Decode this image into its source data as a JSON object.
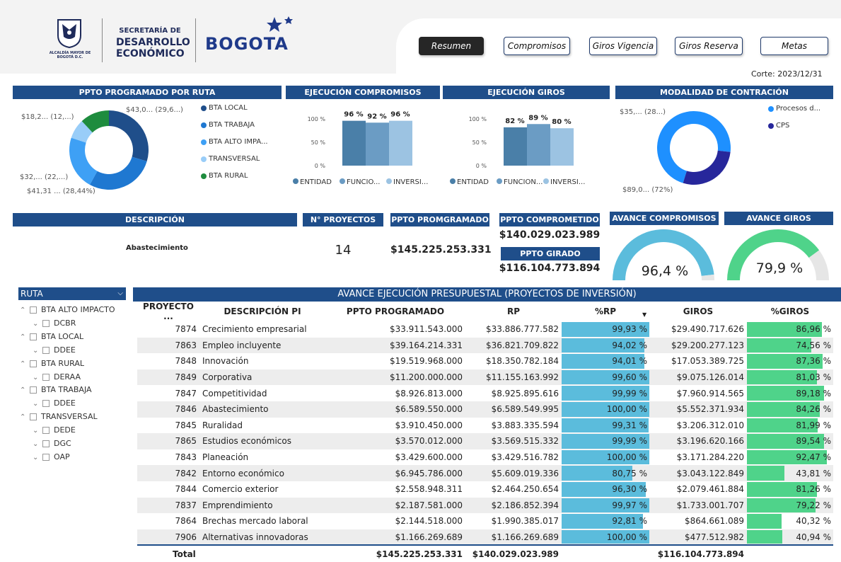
{
  "header": {
    "alcaldia_text": "ALCALDÍA MAYOR DE BOGOTÁ D.C.",
    "secretaria_line1": "SECRETARÍA DE",
    "secretaria_line2": "DESARROLLO",
    "secretaria_line3": "ECONÓMICO",
    "bogota_logo": "BOGOTA"
  },
  "nav": {
    "resumen": "Resumen",
    "compromisos": "Compromisos",
    "giros_vigencia": "Giros Vigencia",
    "giros_reserva": "Giros Reserva",
    "metas": "Metas"
  },
  "corte": "Corte: 2023/12/31",
  "ppto_ruta": {
    "title": "PPTO PROGRAMADO POR RUTA",
    "labels": {
      "local": "$43,0... (29,6...)",
      "rural": "$18,2... (12,...)",
      "transversal": "$32,... (22,...)",
      "trabajo": "$41,31 ... (28,44%)"
    },
    "legend": [
      "BTA LOCAL",
      "BTA TRABAJA",
      "BTA ALTO IMPA...",
      "TRANSVERSAL",
      "BTA RURAL"
    ],
    "colors": [
      "#1f4e8a",
      "#1f78d1",
      "#3ea0f5",
      "#99cdf8",
      "#1e8c3e"
    ]
  },
  "ejec_compromisos": {
    "title": "EJECUCIÓN COMPROMISOS",
    "y_ticks": [
      "100 %",
      "50 %",
      "0 %"
    ],
    "bar_labels": [
      "96 %",
      "92 %",
      "96 %"
    ],
    "legend": [
      "ENTIDAD",
      "FUNCIO...",
      "INVERSI..."
    ]
  },
  "ejec_giros": {
    "title": "EJECUCIÓN GIROS",
    "y_ticks": [
      "100 %",
      "50 %",
      "0 %"
    ],
    "bar_labels": [
      "82 %",
      "89 %",
      "80 %"
    ],
    "legend": [
      "ENTIDAD",
      "FUNCION...",
      "INVERSI..."
    ]
  },
  "modalidad": {
    "title": "MODALIDAD DE CONTRACIÓN",
    "label_top": "$35,... (28...)",
    "label_bottom": "$89,0... (72%)",
    "legend": [
      "Procesos d...",
      "CPS"
    ]
  },
  "kpi": {
    "descripcion_header": "DESCRIPCIÓN",
    "descripcion_value": "Abastecimiento",
    "n_proyectos_header": "N° PROYECTOS",
    "n_proyectos_value": "14",
    "ppto_prog_header": "PPTO PROMGRAMADO",
    "ppto_prog_value": "$145.225.253.331",
    "ppto_comp_header": "PPTO COMPROMETIDO",
    "ppto_comp_value": "$140.029.023.989",
    "ppto_girado_header": "PPTO GIRADO",
    "ppto_girado_value": "$116.104.773.894",
    "avance_comp_header": "AVANCE COMPROMISOS",
    "avance_comp_value": "96,4 %",
    "avance_giros_header": "AVANCE GIROS",
    "avance_giros_value": "79,9 %"
  },
  "slicer": {
    "title": "RUTA",
    "items": [
      {
        "label": "BTA ALTO IMPACTO",
        "level": 0
      },
      {
        "label": "DCBR",
        "level": 1
      },
      {
        "label": "BTA LOCAL",
        "level": 0
      },
      {
        "label": "DDEE",
        "level": 1
      },
      {
        "label": "BTA RURAL",
        "level": 0
      },
      {
        "label": "DERAA",
        "level": 1
      },
      {
        "label": "BTA TRABAJA",
        "level": 0
      },
      {
        "label": "DDEE",
        "level": 1
      },
      {
        "label": "TRANSVERSAL",
        "level": 0
      },
      {
        "label": "DEDE",
        "level": 1
      },
      {
        "label": "DGC",
        "level": 1
      },
      {
        "label": "OAP",
        "level": 1
      }
    ]
  },
  "table": {
    "title": "AVANCE EJECUCIÓN PRESUPUESTAL (PROYECTOS DE INVERSIÓN)",
    "columns": [
      "PROYECTO ...",
      "DESCRIPCIÓN PI",
      "PPTO PROGRAMADO",
      "RP",
      "%RP",
      "GIROS",
      "%GIROS"
    ],
    "rows": [
      {
        "proyecto": "7874",
        "descripcion": "Crecimiento empresarial",
        "ppto": "$33.911.543.000",
        "rp": "$33.886.777.582",
        "pct_rp": "99,93 %",
        "rp_val": 99.93,
        "giros": "$29.490.717.626",
        "pct_giros": "86,96 %",
        "giros_val": 86.96
      },
      {
        "proyecto": "7863",
        "descripcion": "Empleo incluyente",
        "ppto": "$39.164.214.331",
        "rp": "$36.821.709.822",
        "pct_rp": "94,02 %",
        "rp_val": 94.02,
        "giros": "$29.200.277.123",
        "pct_giros": "74,56 %",
        "giros_val": 74.56
      },
      {
        "proyecto": "7848",
        "descripcion": "Innovación",
        "ppto": "$19.519.968.000",
        "rp": "$18.350.782.184",
        "pct_rp": "94,01 %",
        "rp_val": 94.01,
        "giros": "$17.053.389.725",
        "pct_giros": "87,36 %",
        "giros_val": 87.36
      },
      {
        "proyecto": "7849",
        "descripcion": "Corporativa",
        "ppto": "$11.200.000.000",
        "rp": "$11.155.163.992",
        "pct_rp": "99,60 %",
        "rp_val": 99.6,
        "giros": "$9.075.126.014",
        "pct_giros": "81,03 %",
        "giros_val": 81.03
      },
      {
        "proyecto": "7847",
        "descripcion": "Competitividad",
        "ppto": "$8.926.813.000",
        "rp": "$8.925.895.616",
        "pct_rp": "99,99 %",
        "rp_val": 99.99,
        "giros": "$7.960.914.565",
        "pct_giros": "89,18 %",
        "giros_val": 89.18
      },
      {
        "proyecto": "7846",
        "descripcion": "Abastecimiento",
        "ppto": "$6.589.550.000",
        "rp": "$6.589.549.995",
        "pct_rp": "100,00 %",
        "rp_val": 100.0,
        "giros": "$5.552.371.934",
        "pct_giros": "84,26 %",
        "giros_val": 84.26
      },
      {
        "proyecto": "7845",
        "descripcion": "Ruralidad",
        "ppto": "$3.910.450.000",
        "rp": "$3.883.335.594",
        "pct_rp": "99,31 %",
        "rp_val": 99.31,
        "giros": "$3.206.312.010",
        "pct_giros": "81,99 %",
        "giros_val": 81.99
      },
      {
        "proyecto": "7865",
        "descripcion": "Estudios económicos",
        "ppto": "$3.570.012.000",
        "rp": "$3.569.515.332",
        "pct_rp": "99,99 %",
        "rp_val": 99.99,
        "giros": "$3.196.620.166",
        "pct_giros": "89,54 %",
        "giros_val": 89.54
      },
      {
        "proyecto": "7843",
        "descripcion": "Planeación",
        "ppto": "$3.429.600.000",
        "rp": "$3.429.516.782",
        "pct_rp": "100,00 %",
        "rp_val": 100.0,
        "giros": "$3.171.284.220",
        "pct_giros": "92,47 %",
        "giros_val": 92.47
      },
      {
        "proyecto": "7842",
        "descripcion": "Entorno económico",
        "ppto": "$6.945.786.000",
        "rp": "$5.609.019.336",
        "pct_rp": "80,75 %",
        "rp_val": 80.75,
        "giros": "$3.043.122.849",
        "pct_giros": "43,81 %",
        "giros_val": 43.81
      },
      {
        "proyecto": "7844",
        "descripcion": "Comercio exterior",
        "ppto": "$2.558.948.311",
        "rp": "$2.464.250.654",
        "pct_rp": "96,30 %",
        "rp_val": 96.3,
        "giros": "$2.079.461.884",
        "pct_giros": "81,26 %",
        "giros_val": 81.26
      },
      {
        "proyecto": "7837",
        "descripcion": "Emprendimiento",
        "ppto": "$2.187.581.000",
        "rp": "$2.186.852.394",
        "pct_rp": "99,97 %",
        "rp_val": 99.97,
        "giros": "$1.733.001.707",
        "pct_giros": "79,22 %",
        "giros_val": 79.22
      },
      {
        "proyecto": "7864",
        "descripcion": "Brechas mercado laboral",
        "ppto": "$2.144.518.000",
        "rp": "$1.990.385.017",
        "pct_rp": "92,81 %",
        "rp_val": 92.81,
        "giros": "$864.661.089",
        "pct_giros": "40,32 %",
        "giros_val": 40.32
      },
      {
        "proyecto": "7906",
        "descripcion": "Alternativas innovadoras",
        "ppto": "$1.166.269.689",
        "rp": "$1.166.269.689",
        "pct_rp": "100,00 %",
        "rp_val": 100.0,
        "giros": "$477.512.982",
        "pct_giros": "40,94 %",
        "giros_val": 40.94
      }
    ],
    "total": {
      "label": "Total",
      "ppto": "$145.225.253.331",
      "rp": "$140.029.023.989",
      "giros": "$116.104.773.894"
    }
  },
  "colors": {
    "header_blue": "#1f4e8a",
    "rp_bar": "#5bbcdc",
    "giros_bar": "#4fd38a"
  }
}
